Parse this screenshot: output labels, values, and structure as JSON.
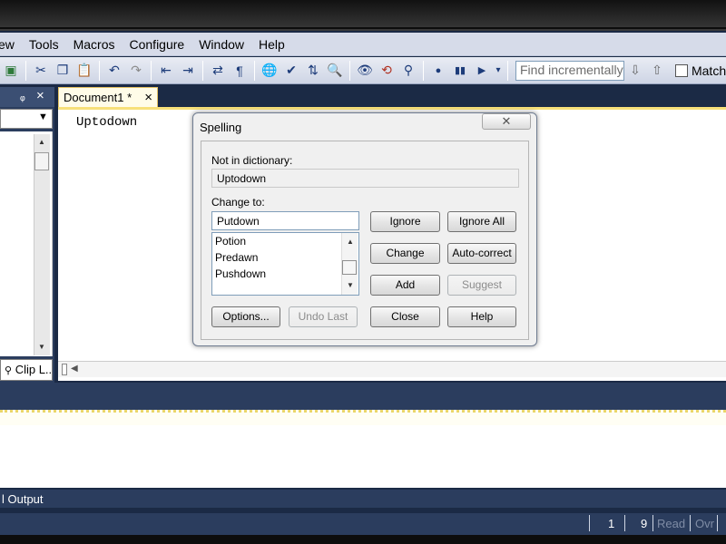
{
  "menubar": {
    "items": [
      "ew",
      "Tools",
      "Macros",
      "Configure",
      "Window",
      "Help"
    ]
  },
  "toolbar": {
    "find_placeholder": "Find incrementally",
    "match_label": "Match"
  },
  "left_panel": {
    "pin_glyph": "ᵩ",
    "close_glyph": "×",
    "tab_label": "Clip L..."
  },
  "document": {
    "tab_label": "Document1 *",
    "tab_close": "×",
    "text": "Uptodown"
  },
  "spelling_dialog": {
    "title": "Spelling",
    "close_glyph": "✕",
    "not_in_dictionary_label": "Not in dictionary:",
    "not_in_dictionary_value": "Uptodown",
    "change_to_label": "Change to:",
    "change_to_value": "Putdown",
    "suggestions": [
      "Potion",
      "Predawn",
      "Pushdown"
    ],
    "buttons": {
      "ignore": "Ignore",
      "ignore_all": "Ignore All",
      "change": "Change",
      "auto_correct": "Auto-correct",
      "add": "Add",
      "suggest": "Suggest",
      "options": "Options...",
      "undo_last": "Undo Last",
      "close": "Close",
      "help": "Help"
    }
  },
  "output_panel": {
    "tab_label": "l Output"
  },
  "statusbar": {
    "line": "1",
    "column": "9",
    "read": "Read",
    "ovr": "Ovr"
  },
  "colors": {
    "chrome_blue": "#2b3d5e",
    "menu_bg": "#d6dbe9",
    "doc_tab": "#fffce8",
    "accent_yellow": "#f7e07a"
  }
}
